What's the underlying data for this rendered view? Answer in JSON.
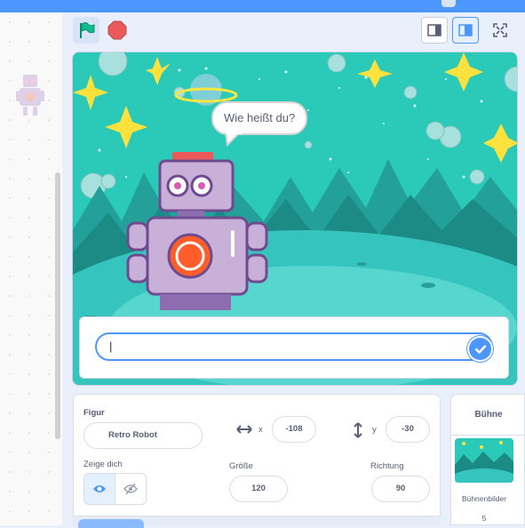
{
  "stage": {
    "speech_bubble": "Wie heißt du?",
    "ask_answer": "|"
  },
  "sprite_info": {
    "sprite_label": "Figur",
    "sprite_name": "Retro Robot",
    "x_label": "x",
    "x_value": "-108",
    "y_label": "y",
    "y_value": "-30",
    "show_label": "Zeige dich",
    "size_label": "Größe",
    "size_value": "120",
    "direction_label": "Richtung",
    "direction_value": "90"
  },
  "stage_panel": {
    "title": "Bühne",
    "backdrops_label": "Bühnenbilder",
    "backdrops_count": "5"
  },
  "colors": {
    "accent": "#4c97ff",
    "stage_sky": "#2ac9b8",
    "stop_red": "#ec5959",
    "flag_green": "#0fbd8c"
  }
}
